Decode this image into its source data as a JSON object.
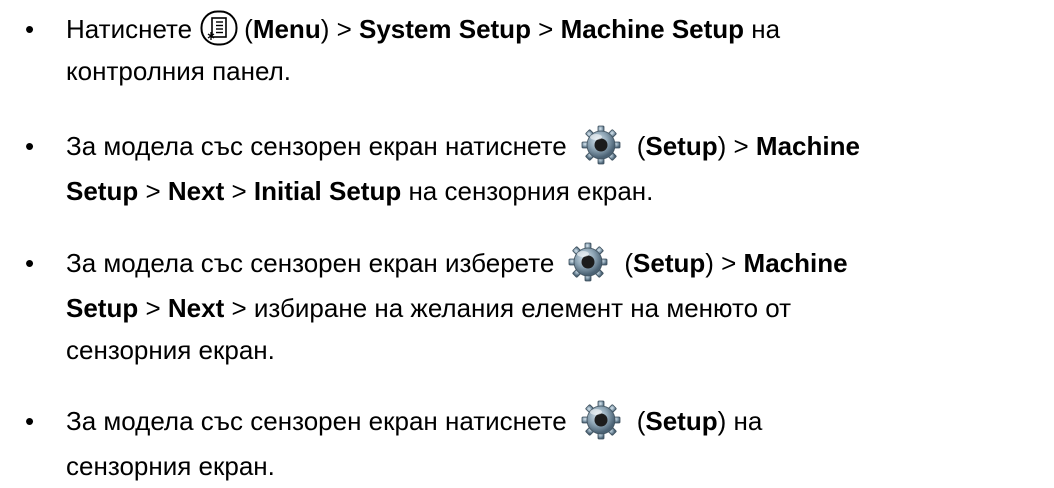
{
  "items": [
    {
      "bullet": "•",
      "t1": "Натиснете",
      "icon": "menu-button-icon",
      "p1": "(",
      "b1": "Menu",
      "p2": ") > ",
      "b2": "System Setup",
      "p3": " > ",
      "b3": "Machine Setup",
      "p4": " на",
      "line2": "контролния панел."
    },
    {
      "bullet": "•",
      "t1": "За модела със сензорен екран натиснете",
      "icon": "setup-gear-icon",
      "p1": "(",
      "b1": "Setup",
      "p2": ") > ",
      "b2": "Machine",
      "l2b1": "Setup",
      "l2p1": " > ",
      "l2b2": "Next",
      "l2p2": " > ",
      "l2b3": "Initial Setup",
      "l2p3": " на сензорния екран."
    },
    {
      "bullet": "•",
      "t1": "За модела със сензорен екран изберете",
      "icon": "setup-gear-icon",
      "p1": "(",
      "b1": "Setup",
      "p2": ") > ",
      "b2": "Machine",
      "l2b1": "Setup",
      "l2p1": " > ",
      "l2b2": "Next",
      "l2p2": " > избиране на желания елемент на менюто от",
      "line3": "сензорния екран."
    },
    {
      "bullet": "•",
      "t1": "За модела със сензорен екран натиснете",
      "icon": "setup-gear-icon",
      "p1": "(",
      "b1": "Setup",
      "p2": ") на",
      "line2": "сензорния екран."
    }
  ]
}
